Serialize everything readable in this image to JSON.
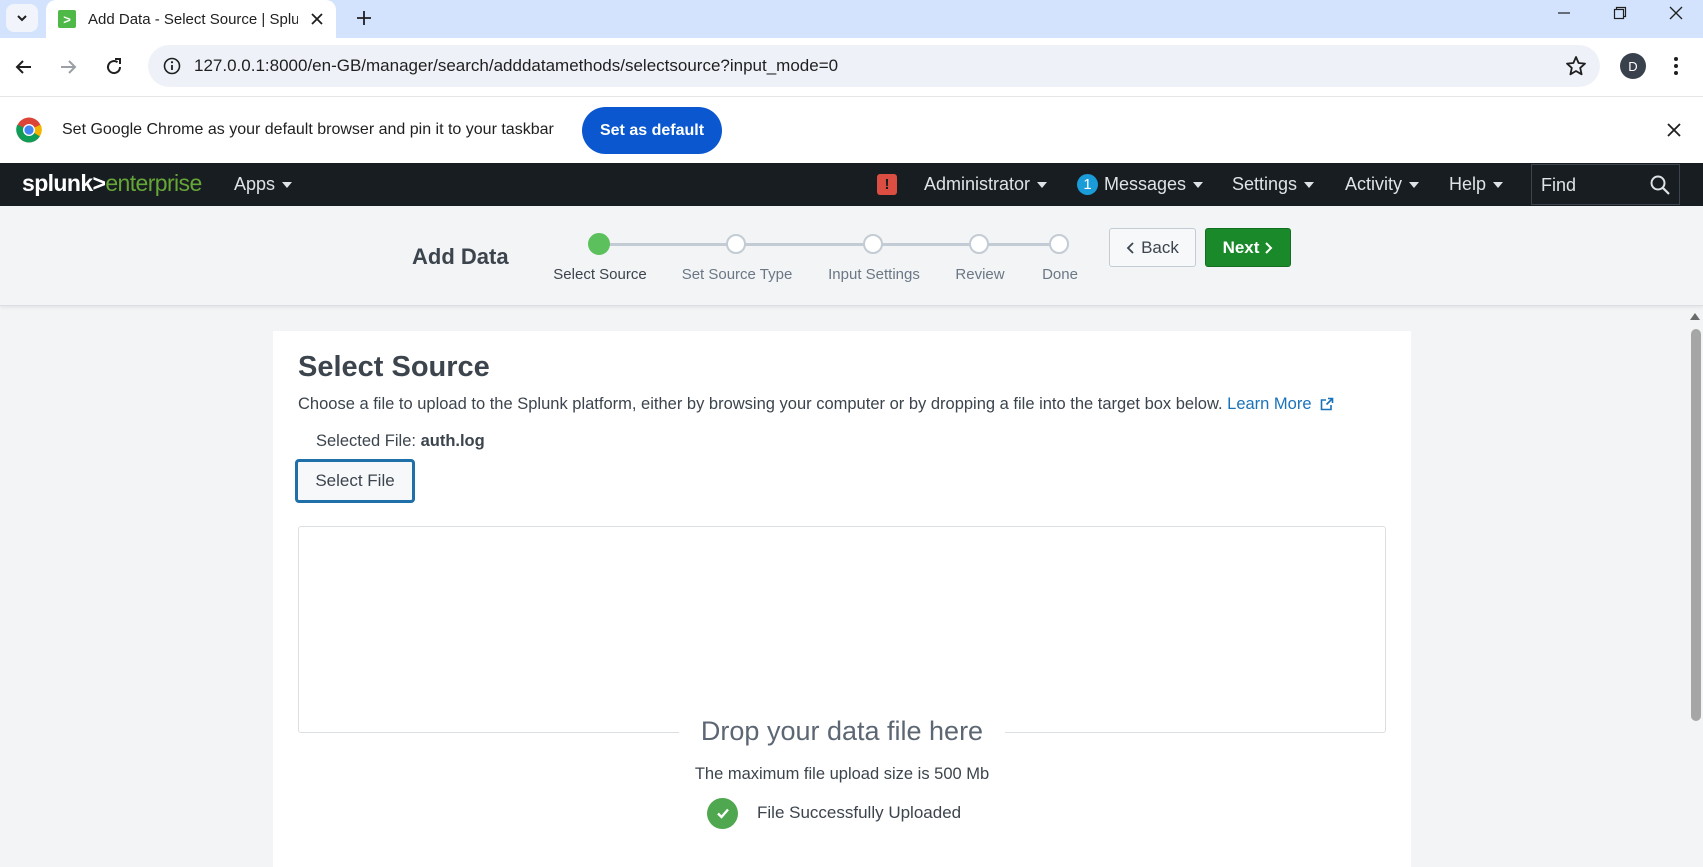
{
  "browser": {
    "tab_title": "Add Data - Select Source | Splunk",
    "url": "127.0.0.1:8000/en-GB/manager/search/adddatamethods/selectsource?input_mode=0",
    "profile_initial": "D"
  },
  "infobar": {
    "message": "Set Google Chrome as your default browser and pin it to your taskbar",
    "set_default_label": "Set as default"
  },
  "splunk_nav": {
    "brand_splunk": "splunk>",
    "brand_enterprise": "enterprise",
    "apps_label": "Apps",
    "alert_symbol": "!",
    "administrator_label": "Administrator",
    "messages_count": "1",
    "messages_label": "Messages",
    "settings_label": "Settings",
    "activity_label": "Activity",
    "help_label": "Help",
    "find_placeholder": "Find"
  },
  "wizard": {
    "title": "Add Data",
    "steps": [
      {
        "label": "Select Source",
        "state": "active"
      },
      {
        "label": "Set Source Type",
        "state": "pending"
      },
      {
        "label": "Input Settings",
        "state": "pending"
      },
      {
        "label": "Review",
        "state": "pending"
      },
      {
        "label": "Done",
        "state": "pending"
      }
    ],
    "back_label": "Back",
    "next_label": "Next"
  },
  "select_source": {
    "title": "Select Source",
    "description": "Choose a file to upload to the Splunk platform, either by browsing your computer or by dropping a file into the target box below.",
    "learn_more": "Learn More",
    "selected_file_label": "Selected File:",
    "selected_file_name": "auth.log",
    "select_file_button": "Select File",
    "drop_title": "Drop your data file here",
    "max_size_text": "The maximum file upload size is 500 Mb",
    "upload_status": "File Successfully Uploaded"
  },
  "colors": {
    "splunk_nav_bg": "#171d21",
    "brand_green": "#65a637",
    "next_button": "#1a8929",
    "active_step": "#5cc05c",
    "link": "#1a73ba",
    "chrome_primary": "#0b57d0",
    "alert_red": "#dc4e41",
    "messages_badge": "#1a9cd9",
    "success_green": "#4fa84f"
  }
}
